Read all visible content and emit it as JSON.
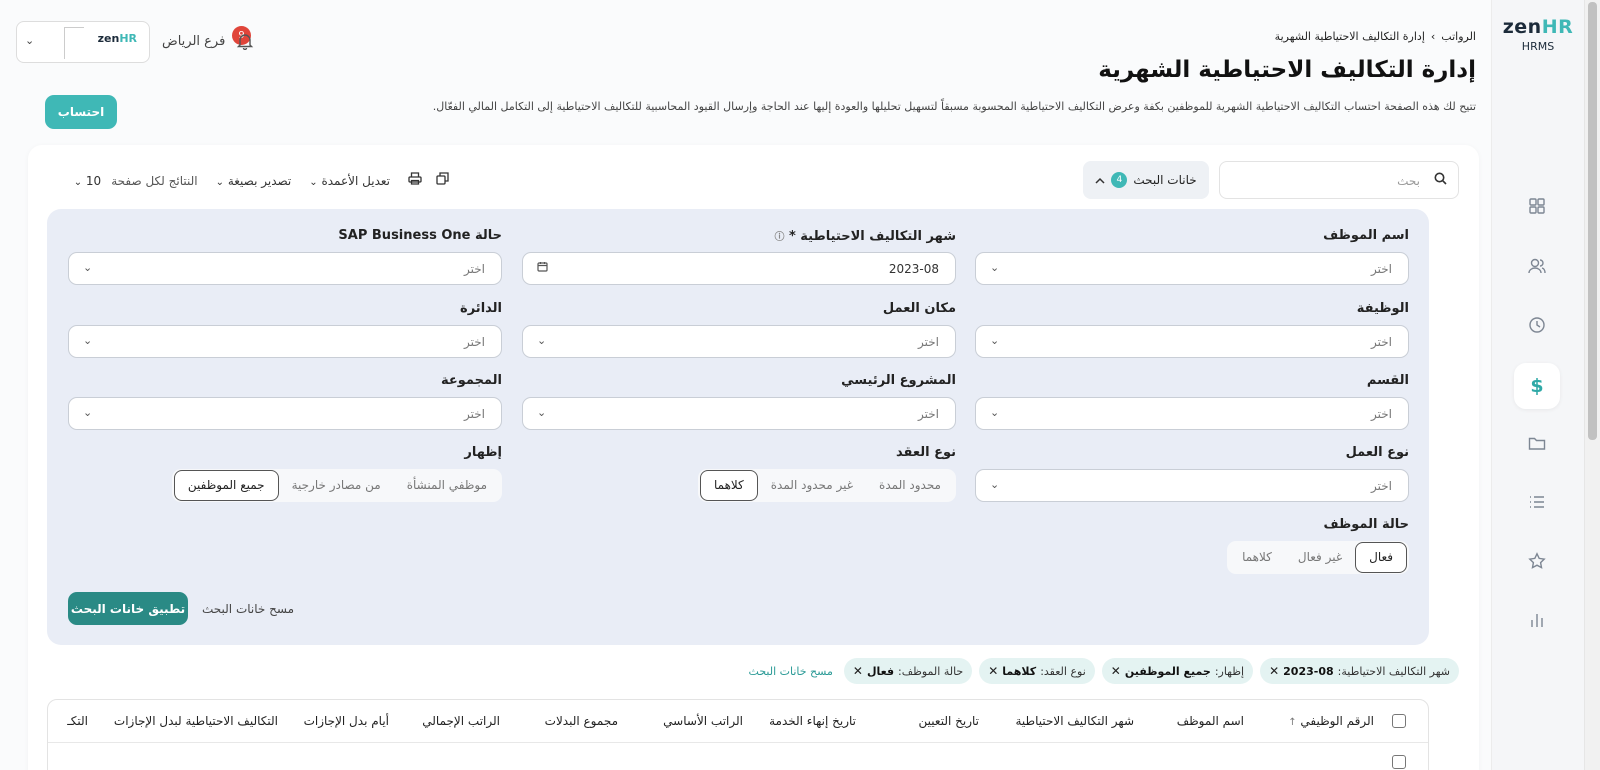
{
  "brand": {
    "logo_main": "zen",
    "logo_accent": "HR",
    "subtitle": "HRMS"
  },
  "sidebar_icons": [
    "grid-icon",
    "users-icon",
    "clock-icon",
    "dollar-icon",
    "folder-icon",
    "list-icon",
    "star-icon",
    "chart-icon"
  ],
  "header": {
    "breadcrumb_root": "الرواتب",
    "breadcrumb_sep": "›",
    "breadcrumb_current": "إدارة التكاليف الاحتياطية الشهرية",
    "title": "إدارة التكاليف الاحتياطية الشهرية",
    "description": "تتيح لك هذه الصفحة احتساب التكاليف الاحتياطية الشهرية للموظفين بكفة وعرض التكاليف الاحتياطية المحسوبة مسبقاً لتسهيل تحليلها والعودة إليها عند الحاجة وإرسال القيود المحاسبية للتكاليف الاحتياطية إلى التكامل المالي الفعّال.",
    "calculate_button": "احتساب"
  },
  "topbar": {
    "branch": "فرع الرياض",
    "notifications": "9",
    "company_logo_main": "zen",
    "company_logo_accent": "HR",
    "chevron": "⌄"
  },
  "toolbar": {
    "search_placeholder": "بحث",
    "filters_label": "خانات البحث",
    "filters_count": "4",
    "edit_columns": "تعديل الأعمدة",
    "export": "تصدير بصيغة",
    "per_page_label": "النتائج لكل صفحة",
    "per_page_value": "10"
  },
  "filters": {
    "employee_name": {
      "label": "اسم الموظف",
      "value": "اختر"
    },
    "reserve_month": {
      "label": "شهر التكاليف الاحتياطية *",
      "value": "2023-08"
    },
    "sap_status": {
      "label": "حالة SAP Business One",
      "value": "اختر"
    },
    "job": {
      "label": "الوظيفة",
      "value": "اختر"
    },
    "work_location": {
      "label": "مكان العمل",
      "value": "اختر"
    },
    "department": {
      "label": "الدائرة",
      "value": "اختر"
    },
    "section": {
      "label": "القسم",
      "value": "اختر"
    },
    "main_project": {
      "label": "المشروع الرئيسي",
      "value": "اختر"
    },
    "group": {
      "label": "المجموعة",
      "value": "اختر"
    },
    "work_type": {
      "label": "نوع العمل",
      "value": "اختر"
    },
    "contract_type": {
      "label": "نوع العقد",
      "options": [
        "محدود المدة",
        "غير محدود المدة",
        "كلاهما"
      ],
      "selected": "كلاهما"
    },
    "show": {
      "label": "إظهار",
      "options": [
        "موظفي المنشأة",
        "من مصادر خارجية",
        "جميع الموظفين"
      ],
      "selected": "جميع الموظفين"
    },
    "employee_status": {
      "label": "حالة الموظف",
      "options": [
        "فعال",
        "غير فعال",
        "كلاهما"
      ],
      "selected": "فعال"
    },
    "apply_button": "تطبيق خانات البحث",
    "clear_button": "مسح خانات البحث"
  },
  "chips": [
    {
      "label": "شهر التكاليف الاحتياطية:",
      "value": "2023-08"
    },
    {
      "label": "إظهار:",
      "value": "جميع الموظفين"
    },
    {
      "label": "نوع العقد:",
      "value": "كلاهما"
    },
    {
      "label": "حالة الموظف:",
      "value": "فعال"
    }
  ],
  "chips_clear": "مسح خانات البحث",
  "table": {
    "columns": [
      "الرقم الوظيفي",
      "اسم الموظف",
      "شهر التكاليف الاحتياطية",
      "تاريخ التعيين",
      "تاريخ إنهاء الخدمة",
      "الراتب الأساسي",
      "مجموع البدلات",
      "الراتب الإجمالي",
      "أيام بدل الإجازات",
      "التكاليف الاحتياطية لبدل الإجازات",
      "التكـ"
    ]
  },
  "colors": {
    "accent": "#3fb8b6",
    "apply": "#2a8a85",
    "badge": "#e0453a"
  }
}
